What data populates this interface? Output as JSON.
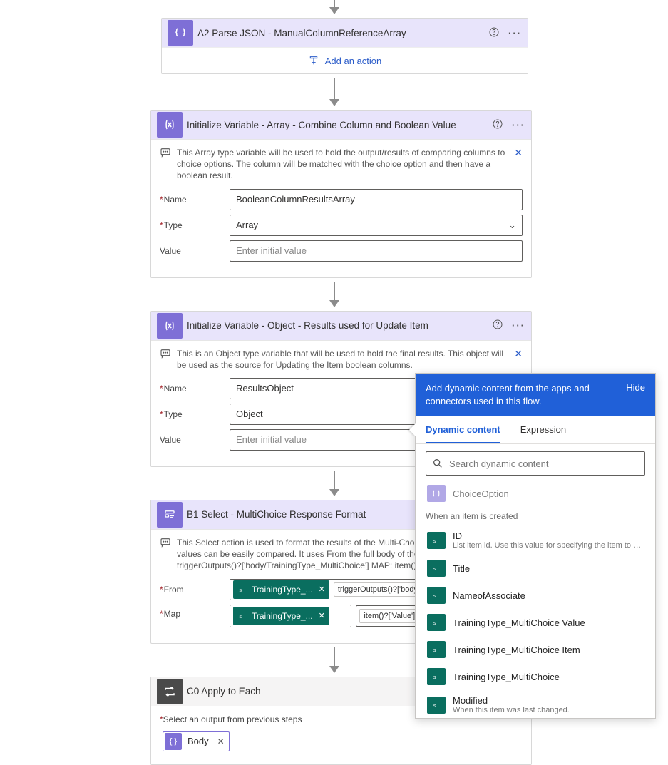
{
  "cards": {
    "a2": {
      "title": "A2 Parse JSON - ManualColumnReferenceArray",
      "add_action": "Add an action"
    },
    "init_array": {
      "title": "Initialize Variable - Array - Combine Column and Boolean Value",
      "desc": "This Array type variable will be used to hold the output/results of comparing columns to choice options. The column will be matched with the choice option and then have a boolean result.",
      "name_label": "Name",
      "name_value": "BooleanColumnResultsArray",
      "type_label": "Type",
      "type_value": "Array",
      "value_label": "Value",
      "value_placeholder": "Enter initial value"
    },
    "init_object": {
      "title": "Initialize Variable - Object - Results used for Update Item",
      "desc": "This is an Object type variable that will be used to hold the final results. This object will be used as the source for Updating the Item boolean columns.",
      "name_label": "Name",
      "name_value": "ResultsObject",
      "type_label": "Type",
      "type_value": "Object",
      "value_label": "Value",
      "value_placeholder": "Enter initial value"
    },
    "b1": {
      "title": "B1 Select - MultiChoice Response Format",
      "desc": "This Select action is used to format the results of the Multi-Choice column so that the values can be easily compared. It uses From the full body of the column. FROM: triggerOutputs()?['body/TrainingType_MultiChoice'] MAP: item()?['Value']",
      "from_label": "From",
      "map_label": "Map",
      "from_pill": "TrainingType_...",
      "from_expr": "triggerOutputs()?['body/TrainingType_MultiChoice']",
      "map_pill": "TrainingType_...",
      "map_expr": "item()?['Value']"
    },
    "c0": {
      "title": "C0 Apply to Each",
      "select_label": "Select an output from previous steps",
      "body_chip": "Body"
    }
  },
  "dynamic_panel": {
    "head": "Add dynamic content from the apps and connectors used in this flow.",
    "hide": "Hide",
    "tab_dynamic": "Dynamic content",
    "tab_expr": "Expression",
    "search_placeholder": "Search dynamic content",
    "choice_option": "ChoiceOption",
    "group": "When an item is created",
    "items": [
      {
        "title": "ID",
        "sub": "List item id. Use this value for specifying the item to act on in other list steps."
      },
      {
        "title": "Title",
        "sub": ""
      },
      {
        "title": "NameofAssociate",
        "sub": ""
      },
      {
        "title": "TrainingType_MultiChoice Value",
        "sub": ""
      },
      {
        "title": "TrainingType_MultiChoice Item",
        "sub": ""
      },
      {
        "title": "TrainingType_MultiChoice",
        "sub": ""
      },
      {
        "title": "Modified",
        "sub": "When this item was last changed."
      }
    ]
  }
}
